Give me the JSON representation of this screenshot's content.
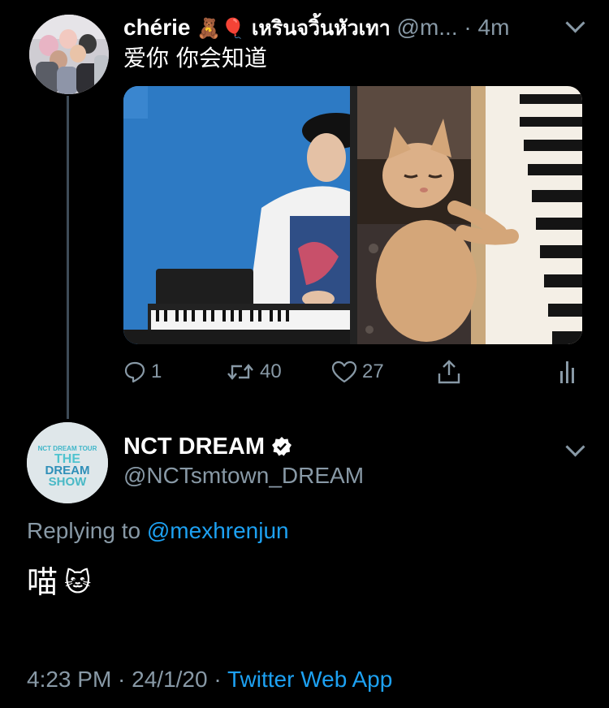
{
  "reply_tweet": {
    "display_name": "chérie",
    "name_emojis": "🧸🎈",
    "thai_name": "เหรินจวิ้นหัวเทา",
    "handle": "@m...",
    "separator": "·",
    "time": "4m",
    "text": "爱你 你会知道",
    "actions": {
      "reply_count": "1",
      "retweet_count": "40",
      "like_count": "27"
    }
  },
  "main_tweet": {
    "display_name": "NCT DREAM",
    "handle": "@NCTsmtown_DREAM",
    "avatar_text": {
      "line1": "NCT DREAM TOUR",
      "line2": "THE",
      "line3": "DREAM",
      "line4": "SHOW"
    },
    "replying_prefix": "Replying to",
    "replying_to": "@mexhrenjun",
    "text": "喵",
    "emoji": "🐱",
    "timestamp": "4:23 PM · 24/1/20 ·",
    "source": "Twitter Web App"
  },
  "colors": {
    "background": "#000000",
    "muted": "#8899a6",
    "link": "#1da1f2",
    "thread_line": "#3d4a57"
  },
  "icons": [
    "reply-icon",
    "retweet-icon",
    "like-icon",
    "share-icon",
    "analytics-icon",
    "verified-badge-icon",
    "chevron-down-icon",
    "teddy-bear-emoji",
    "balloon-emoji",
    "cat-face-emoji"
  ]
}
